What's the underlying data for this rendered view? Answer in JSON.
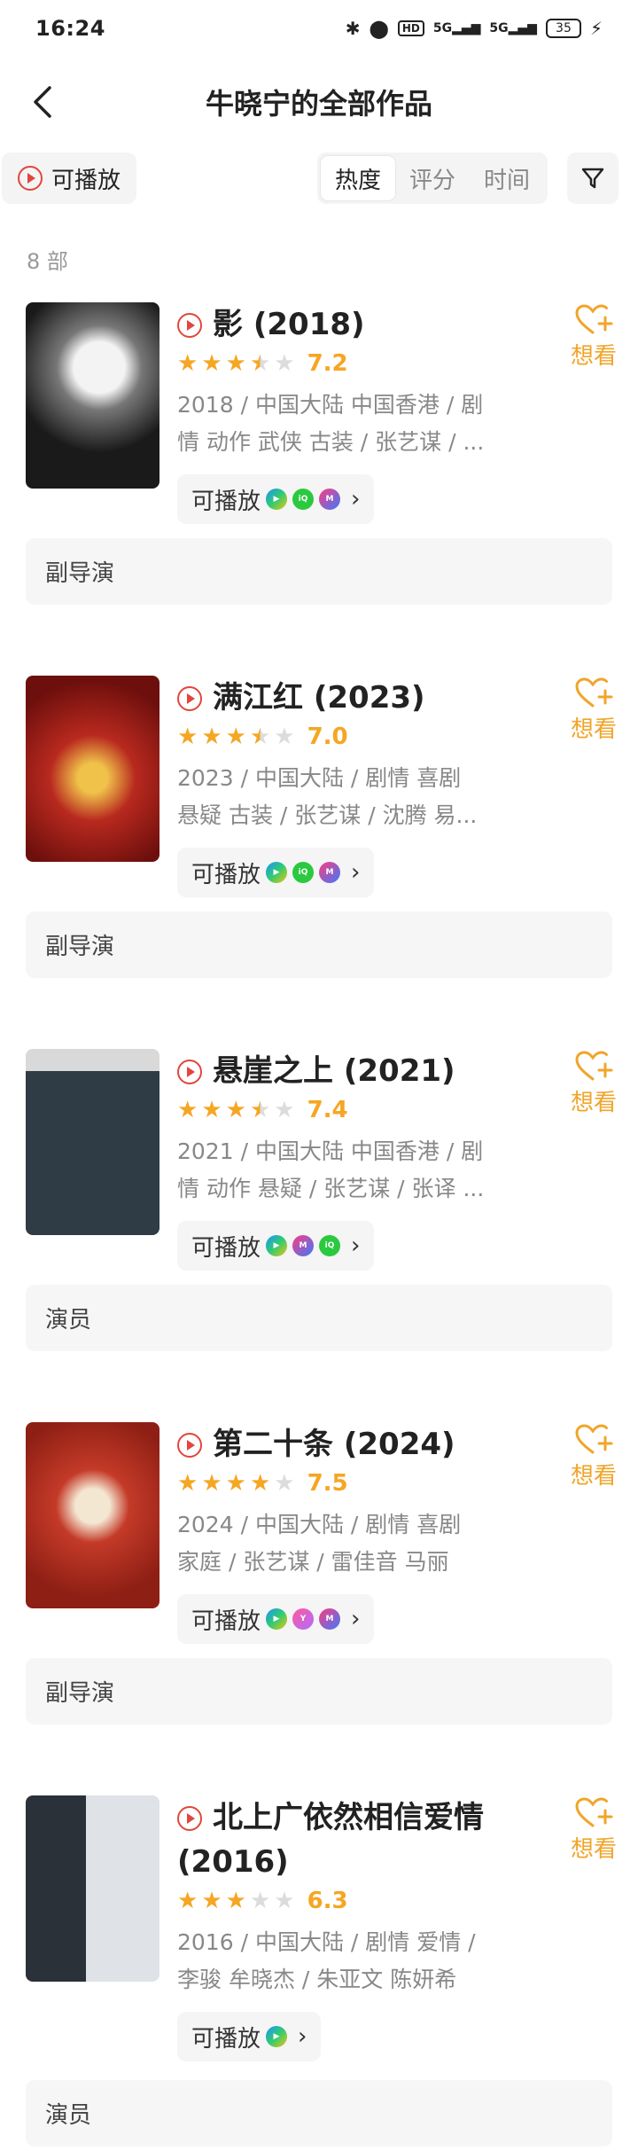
{
  "status_bar": {
    "time": "16:24",
    "battery": "35"
  },
  "nav": {
    "title": "牛晓宁的全部作品"
  },
  "toolbar": {
    "playable_label": "可播放",
    "sort_tabs": [
      "热度",
      "评分",
      "时间"
    ],
    "active_sort": "热度"
  },
  "count_label": "8 部",
  "chip_label": "可播放",
  "want_label": "想看",
  "colors": {
    "accent_orange": "#f5a623",
    "play_red": "#e2463c",
    "want_orange": "#f0a52a"
  },
  "movies": [
    {
      "title": "影 (2018)",
      "rating": 7.2,
      "stars": 3.5,
      "meta1": "2018 / 中国大陆 中国香港 / 剧",
      "meta2": "情 动作 武侠 古装 / 张艺谋 / ...",
      "platforms": [
        "tencent",
        "iqiyi",
        "mgtv"
      ],
      "role": "副导演"
    },
    {
      "title": "满江红 (2023)",
      "rating": 7.0,
      "stars": 3.5,
      "meta1": "2023 / 中国大陆 / 剧情 喜剧",
      "meta2": "悬疑 古装 / 张艺谋 / 沈腾 易...",
      "platforms": [
        "tencent",
        "iqiyi",
        "mgtv"
      ],
      "role": "副导演"
    },
    {
      "title": "悬崖之上 (2021)",
      "rating": 7.4,
      "stars": 3.5,
      "meta1": "2021 / 中国大陆 中国香港 / 剧",
      "meta2": "情 动作 悬疑 / 张艺谋 / 张译 ...",
      "platforms": [
        "tencent",
        "mgtv",
        "iqiyi"
      ],
      "role": "演员"
    },
    {
      "title": "第二十条 (2024)",
      "rating": 7.5,
      "stars": 4,
      "meta1": "2024 / 中国大陆 / 剧情 喜剧",
      "meta2": "家庭 / 张艺谋 / 雷佳音 马丽",
      "platforms": [
        "tencent",
        "youku",
        "mgtv"
      ],
      "role": "副导演"
    },
    {
      "title": "北上广依然相信爱情 (2016)",
      "rating": 6.3,
      "stars": 3,
      "meta1": "2016 / 中国大陆 / 剧情 爱情 /",
      "meta2": "李骏 牟晓杰 / 朱亚文 陈妍希",
      "platforms": [
        "tencent"
      ],
      "role": "演员"
    }
  ]
}
